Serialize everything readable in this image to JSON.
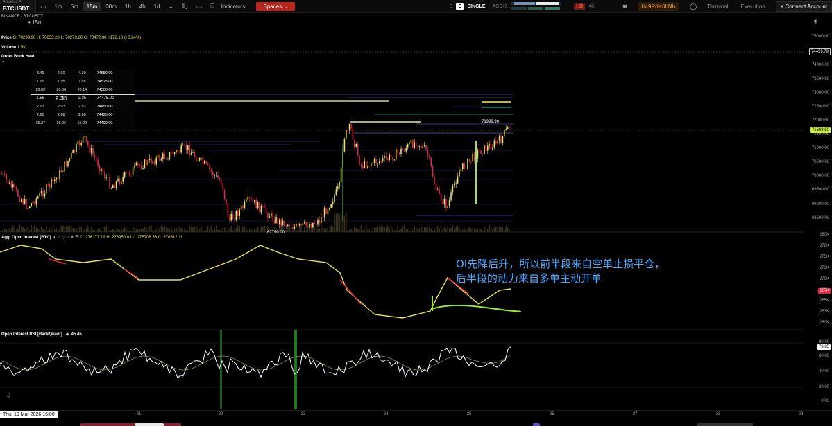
{
  "toolbar": {
    "exchange": "BINANCE",
    "symbol": "BTCUSDT",
    "timeframes": [
      "1m",
      "5m",
      "15m",
      "30m",
      "1h",
      "4h",
      "1d"
    ],
    "active_timeframe": "15m",
    "indicators_label": "Indicators",
    "spaces_label": "Spaces",
    "s_label": "S",
    "c_label": "C",
    "single_label": "SINGLE",
    "aggr_label": "AGGR.",
    "hd_label": "HD",
    "four_k_label": "4K",
    "account_label": "Hc9RdK6bNb",
    "terminal_label": "Terminal",
    "execution_label": "Execution",
    "connect_label": "Connect Account"
  },
  "main_pane": {
    "symbol_line": "BINANCE / BTCUSDT",
    "interval": "15m",
    "price_legend": "Price",
    "ohlc": {
      "o": "O: 70299.90",
      "h": "H: 70655.20",
      "l": "L: 70279.80",
      "c": "C: 70472.00",
      "chg": "+172.10",
      "pct": "(+0.24%)"
    },
    "volume_label": "Volume",
    "volume_value": "1.5K",
    "heatmap_label": "Order Book Heat",
    "y_labels": [
      "75000.00",
      "74500.00",
      "74000.00",
      "73500.00",
      "73000.00",
      "72500.00",
      "72000.00",
      "71500.00",
      "71000.00",
      "70500.00",
      "70000.00",
      "69500.00",
      "69000.00",
      "68500.00"
    ],
    "crosshair_price": "74499.79",
    "current_price": "71693.50",
    "marker_high": "71999.90",
    "marker_low": "67790.00"
  },
  "order_book": {
    "rows": [
      [
        "3.49",
        "4.30",
        "4.30",
        "74550.00"
      ],
      [
        "7.95",
        "7.95",
        "7.95",
        "74525.00"
      ],
      [
        "20.09",
        "20.06",
        "20.14",
        "74500.00"
      ],
      [
        "1.55",
        "2.35",
        "2.35",
        "74475.00"
      ],
      [
        "2.93",
        "2.93",
        "2.93",
        "74450.00"
      ],
      [
        "2.68",
        "2.68",
        "2.68",
        "74425.00"
      ],
      [
        "15.27",
        "15.26",
        "15.29",
        "74400.00"
      ]
    ],
    "mid_row_index": 3
  },
  "oi_pane": {
    "title": "Agg. Open Interest (BTC)",
    "ohlc": {
      "o": "O: 276177.19",
      "h": "H: 276950.03",
      "l": "L: 275708.86",
      "c": "C: 276512.11"
    },
    "y_labels": [
      "280K",
      "278K",
      "275K",
      "273K",
      "270K",
      "268K",
      "265K",
      "263K",
      "260K"
    ],
    "current_badge": "267K",
    "annotation_line1": "OI先降后升，所以前半段来自空单止损平仓，",
    "annotation_line2": "后半段的动力来自多单主动开单"
  },
  "rsi_pane": {
    "title": "Open Interest RSI [BackQuant]",
    "value": "45.45",
    "y_labels": [
      "80.00",
      "60.00",
      "40.00",
      "20.00",
      "0.00"
    ],
    "current_badge": "73.85"
  },
  "x_axis": {
    "labels": [
      "21",
      "22",
      "23",
      "24",
      "25",
      "26",
      "27",
      "28",
      "29"
    ],
    "crosshair_time": "Thu, 19 Mar 2026 16:00"
  },
  "colors": {
    "up": "#e8e060",
    "down": "#d6284a",
    "current_price_badge": "#c6f03a",
    "oi_badge": "#e8203e",
    "annotation": "#4aa8ff",
    "spaces_button": "#b8271d",
    "green_line": "#9be83a"
  },
  "icons": [
    "star-icon",
    "chart-type-icon",
    "bar-style-icon",
    "settings-icon",
    "camera-icon",
    "user-icon",
    "layers-icon",
    "eye-icon",
    "chevron-up-icon",
    "chevron-down-icon"
  ]
}
